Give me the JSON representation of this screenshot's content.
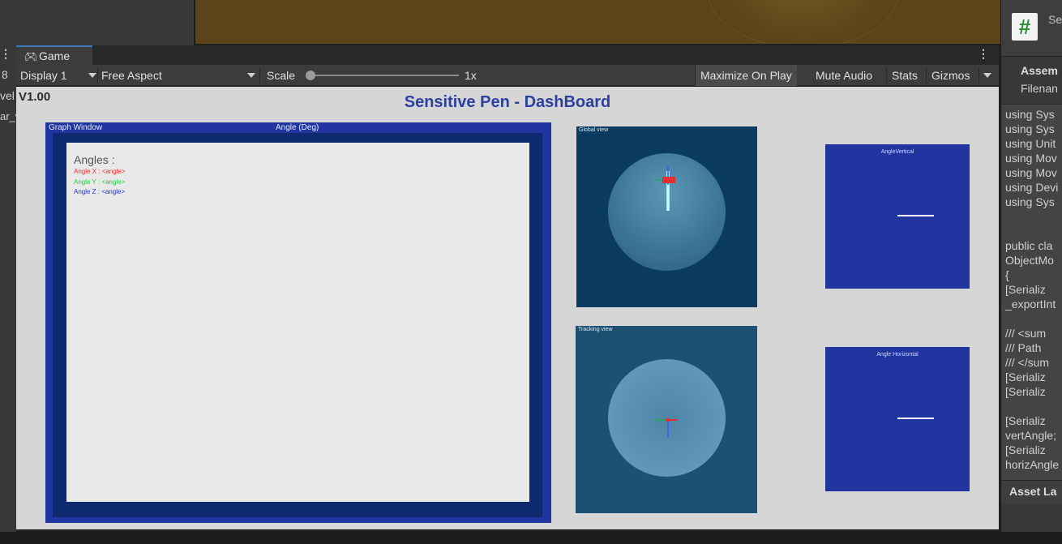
{
  "left_panel": {
    "items": [
      "8",
      "vel",
      "ar_v"
    ]
  },
  "tab": {
    "label": "Game",
    "icon": "gamepad-icon"
  },
  "toolbar": {
    "display": "Display 1",
    "aspect": "Free Aspect",
    "scale_label": "Scale",
    "scale_value": "1x",
    "scale_fraction": 0.0,
    "maximize": "Maximize On Play",
    "mute": "Mute Audio",
    "stats": "Stats",
    "gizmos": "Gizmos"
  },
  "game": {
    "version": "V1.00",
    "title": "Sensitive Pen - DashBoard",
    "graph": {
      "window_label": "Graph Window",
      "axis_label": "Angle (Deg)",
      "angles_title": "Angles :",
      "lines": [
        {
          "text": "Angle X : <angle>",
          "color": "#ff2a2a"
        },
        {
          "text": "Angle Y : <angle>",
          "color": "#22cc44"
        },
        {
          "text": "Angle Z : <angle>",
          "color": "#2233cc"
        }
      ]
    },
    "global_view_label": "Global view",
    "tracking_view_label": "Tracking view",
    "angle_vertical_label": "AngleVertical",
    "angle_horizontal_label": "Angle Horizontal"
  },
  "inspector": {
    "title": "Se",
    "assembly": "Assem",
    "filename": "Filenan",
    "code_lines": [
      "using Sys",
      "using Sys",
      "using Unit",
      "using Mov",
      "using Mov",
      "using Devi",
      "using Sys",
      "",
      "",
      "public cla",
      "ObjectMo",
      "{",
      "    [Serializ",
      "_exportInt",
      "",
      "    /// <sum",
      "    /// Path",
      "    /// </sum",
      "    [Serializ",
      "    [Serializ",
      "",
      "    [Serializ",
      "vertAngle;",
      "    [Serializ",
      "horizAngle"
    ],
    "asset_label": "Asset La"
  },
  "colors": {
    "accent": "#3a79bb",
    "dash_blue": "#2035a0",
    "title_blue": "#2c40a0"
  }
}
